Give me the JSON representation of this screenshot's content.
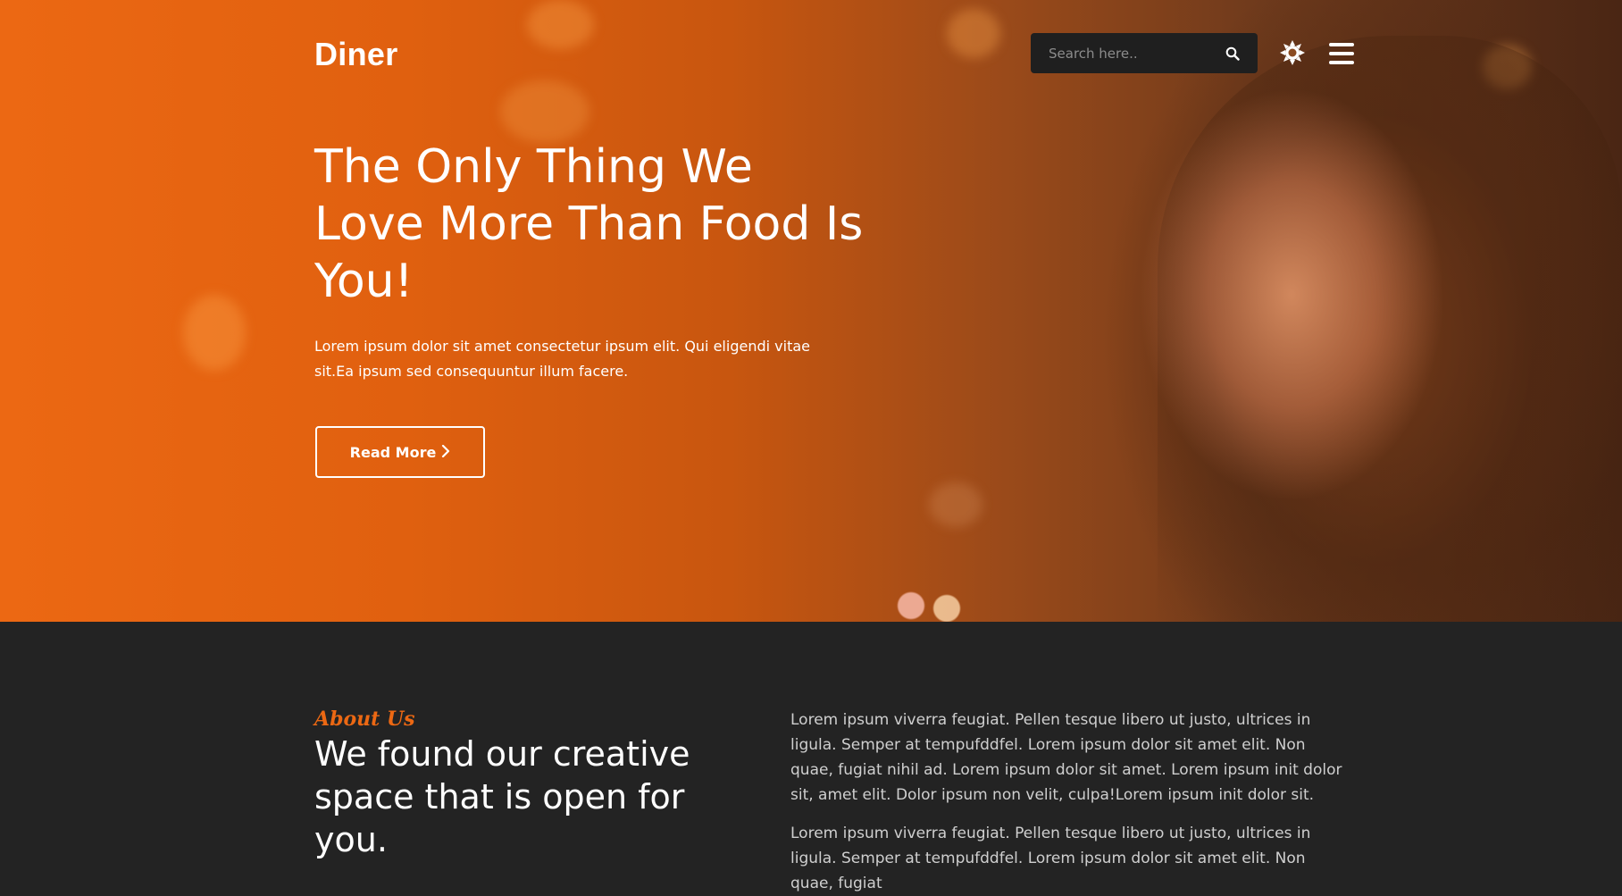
{
  "header": {
    "brand": "Diner",
    "search_placeholder": "Search here..",
    "theme_toggle_icon": "sun-icon",
    "menu_icon": "hamburger-menu-icon"
  },
  "hero": {
    "title": "The Only Thing We Love More Than Food Is You!",
    "text": "Lorem ipsum dolor sit amet consectetur ipsum elit. Qui eligendi vitae sit.Ea ipsum sed consequuntur illum facere.",
    "cta_label": "Read More",
    "cta_icon": "chevron-right-icon"
  },
  "about": {
    "kicker": "About Us",
    "heading": "We found our creative space that is open for you.",
    "paragraphs": [
      "Lorem ipsum viverra feugiat. Pellen tesque libero ut justo, ultrices in ligula. Semper at tempufddfel. Lorem ipsum dolor sit amet elit. Non quae, fugiat nihil ad. Lorem ipsum dolor sit amet. Lorem ipsum init dolor sit, amet elit. Dolor ipsum non velit, culpa!Lorem ipsum init dolor sit.",
      "Lorem ipsum viverra feugiat. Pellen tesque libero ut justo, ultrices in ligula. Semper at tempufddfel. Lorem ipsum dolor sit amet elit. Non quae, fugiat"
    ]
  },
  "colors": {
    "accent": "#ec6813",
    "dark_bg": "#232323",
    "search_bg": "#1f1f1f"
  }
}
